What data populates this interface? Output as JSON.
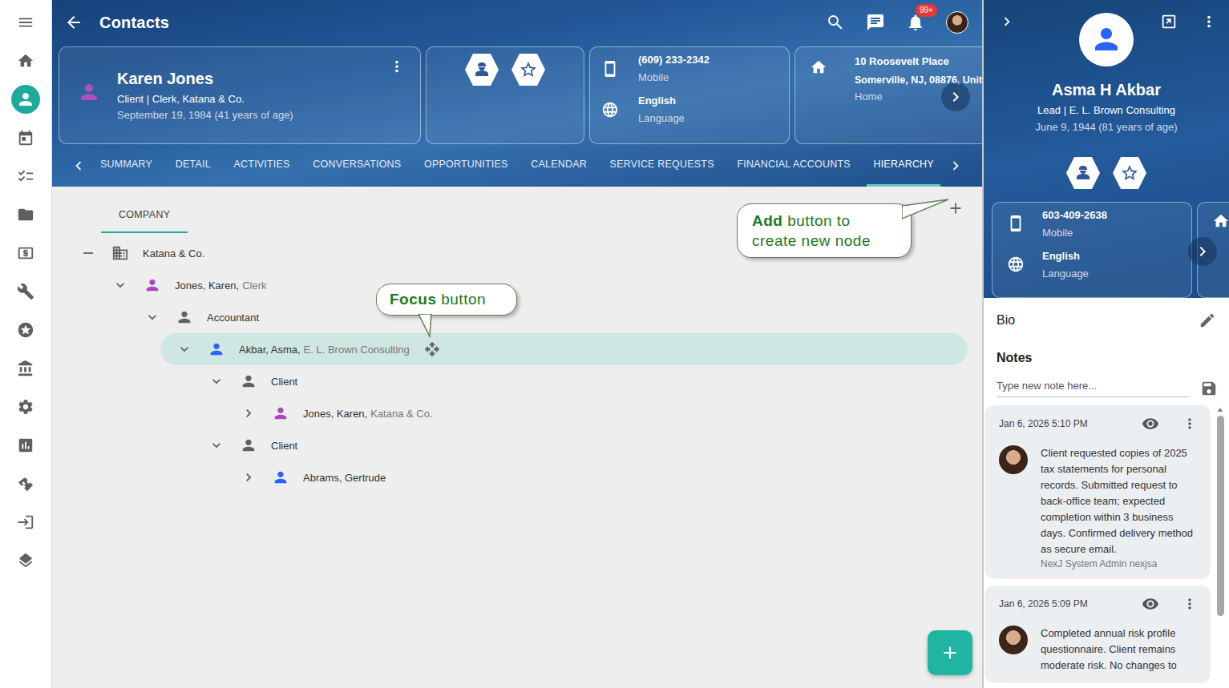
{
  "rail": [
    {
      "kind": "menu",
      "selected": false
    },
    {
      "kind": "home",
      "selected": false
    },
    {
      "kind": "contacts",
      "selected": true
    },
    {
      "kind": "calendar",
      "selected": false
    },
    {
      "kind": "tasks",
      "selected": false
    },
    {
      "kind": "folder",
      "selected": false
    },
    {
      "kind": "money",
      "selected": false
    },
    {
      "kind": "wrench",
      "selected": false
    },
    {
      "kind": "star",
      "selected": false
    },
    {
      "kind": "bank",
      "selected": false
    },
    {
      "kind": "gear",
      "selected": false
    },
    {
      "kind": "chart",
      "selected": false
    },
    {
      "kind": "handshake",
      "selected": false
    },
    {
      "kind": "login",
      "selected": false
    },
    {
      "kind": "layers",
      "selected": false
    }
  ],
  "header": {
    "title": "Contacts",
    "notificationBadge": "99+"
  },
  "contact": {
    "name": "Karen Jones",
    "subtitle": "Client | Clerk, Katana & Co.",
    "dob": "September 19, 1984 (41 years of age)",
    "phone": "(609) 233-2342",
    "phoneLabel": "Mobile",
    "language": "English",
    "languageLabel": "Language",
    "addressLine1": "10 Roosevelt Place",
    "addressLine2": "Somerville, NJ, 08876, Unit",
    "addressLabel": "Home"
  },
  "tabs": [
    {
      "label": "SUMMARY",
      "selected": false
    },
    {
      "label": "DETAIL",
      "selected": false
    },
    {
      "label": "ACTIVITIES",
      "selected": false
    },
    {
      "label": "CONVERSATIONS",
      "selected": false
    },
    {
      "label": "OPPORTUNITIES",
      "selected": false
    },
    {
      "label": "CALENDAR",
      "selected": false
    },
    {
      "label": "SERVICE REQUESTS",
      "selected": false
    },
    {
      "label": "FINANCIAL ACCOUNTS",
      "selected": false
    },
    {
      "label": "HIERARCHY",
      "selected": true
    }
  ],
  "subtabs": [
    {
      "label": "COMPANY",
      "selected": true
    }
  ],
  "tree": [
    {
      "depth": 0,
      "kind": "company",
      "expanded": true,
      "name": "Katana & Co.",
      "detail": "",
      "color": "#616161",
      "selected": false
    },
    {
      "depth": 1,
      "kind": "person",
      "expanded": true,
      "name": "Jones, Karen,",
      "detail": "Clerk",
      "color": "#ab47bc",
      "selected": false
    },
    {
      "depth": 2,
      "kind": "role",
      "expanded": true,
      "name": "Accountant",
      "detail": "",
      "color": "#616161",
      "selected": false
    },
    {
      "depth": 3,
      "kind": "person",
      "expanded": true,
      "name": "Akbar, Asma,",
      "detail": "E. L. Brown Consulting",
      "color": "#2962ff",
      "selected": true
    },
    {
      "depth": 4,
      "kind": "role",
      "expanded": true,
      "name": "Client",
      "detail": "",
      "color": "#616161",
      "selected": false
    },
    {
      "depth": 5,
      "kind": "person",
      "expanded": false,
      "name": "Jones, Karen,",
      "detail": "Katana & Co.",
      "color": "#ab47bc",
      "selected": false
    },
    {
      "depth": 4,
      "kind": "role",
      "expanded": true,
      "name": "Client",
      "detail": "",
      "color": "#616161",
      "selected": false
    },
    {
      "depth": 5,
      "kind": "person",
      "expanded": false,
      "name": "Abrams, Gertrude",
      "detail": "",
      "color": "#2962ff",
      "selected": false
    }
  ],
  "callouts": {
    "add": {
      "bold": "Add",
      "rest": " button to create new node"
    },
    "focus": {
      "bold": "Focus",
      "rest": " button"
    }
  },
  "panel": {
    "name": "Asma H Akbar",
    "subtitle": "Lead | E. L. Brown Consulting",
    "dob": "June 9, 1944 (81 years of age)",
    "phone": "603-409-2638",
    "phoneLabel": "Mobile",
    "language": "English",
    "languageLabel": "Language",
    "bioTitle": "Bio",
    "notesTitle": "Notes",
    "notePlaceholder": "Type new note here...",
    "notes": [
      {
        "date": "Jan 6, 2026 5:10 PM",
        "text": "Client requested copies of 2025 tax statements for personal records. Submitted request to back-office team; expected completion within 3 business days. Confirmed delivery method as secure email.",
        "author": "NexJ System Admin nexjsa"
      },
      {
        "date": "Jan 6, 2026 5:09 PM",
        "text": "Completed annual risk profile questionnaire. Client remains moderate risk. No changes to",
        "author": ""
      }
    ]
  }
}
